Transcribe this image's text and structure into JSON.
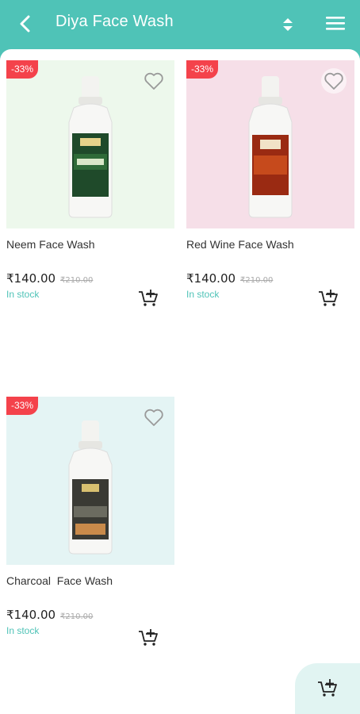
{
  "header": {
    "title": "Diya Face Wash",
    "back_icon": "arrow-left-icon",
    "sort_icon": "sort-updown-icon",
    "menu_icon": "hamburger-menu-icon"
  },
  "colors": {
    "accent": "#4fc3b7",
    "badge": "#f4424b",
    "fab_bg": "#e1f4f2"
  },
  "products": [
    {
      "name": "Neem Face Wash",
      "discount": "-33%",
      "price": "₹140.00",
      "old_price": "₹210.00",
      "stock": "In stock",
      "bg": "#edf8ec"
    },
    {
      "name": "Red Wine Face Wash",
      "discount": "-33%",
      "price": "₹140.00",
      "old_price": "₹210.00",
      "stock": "In stock",
      "bg": "#f6dfe8"
    },
    {
      "name": "Charcoal  Face Wash",
      "discount": "-33%",
      "price": "₹140.00",
      "old_price": "₹210.00",
      "stock": "In stock",
      "bg": "#e4f4f4"
    }
  ],
  "fab_icon": "add-to-cart-icon"
}
